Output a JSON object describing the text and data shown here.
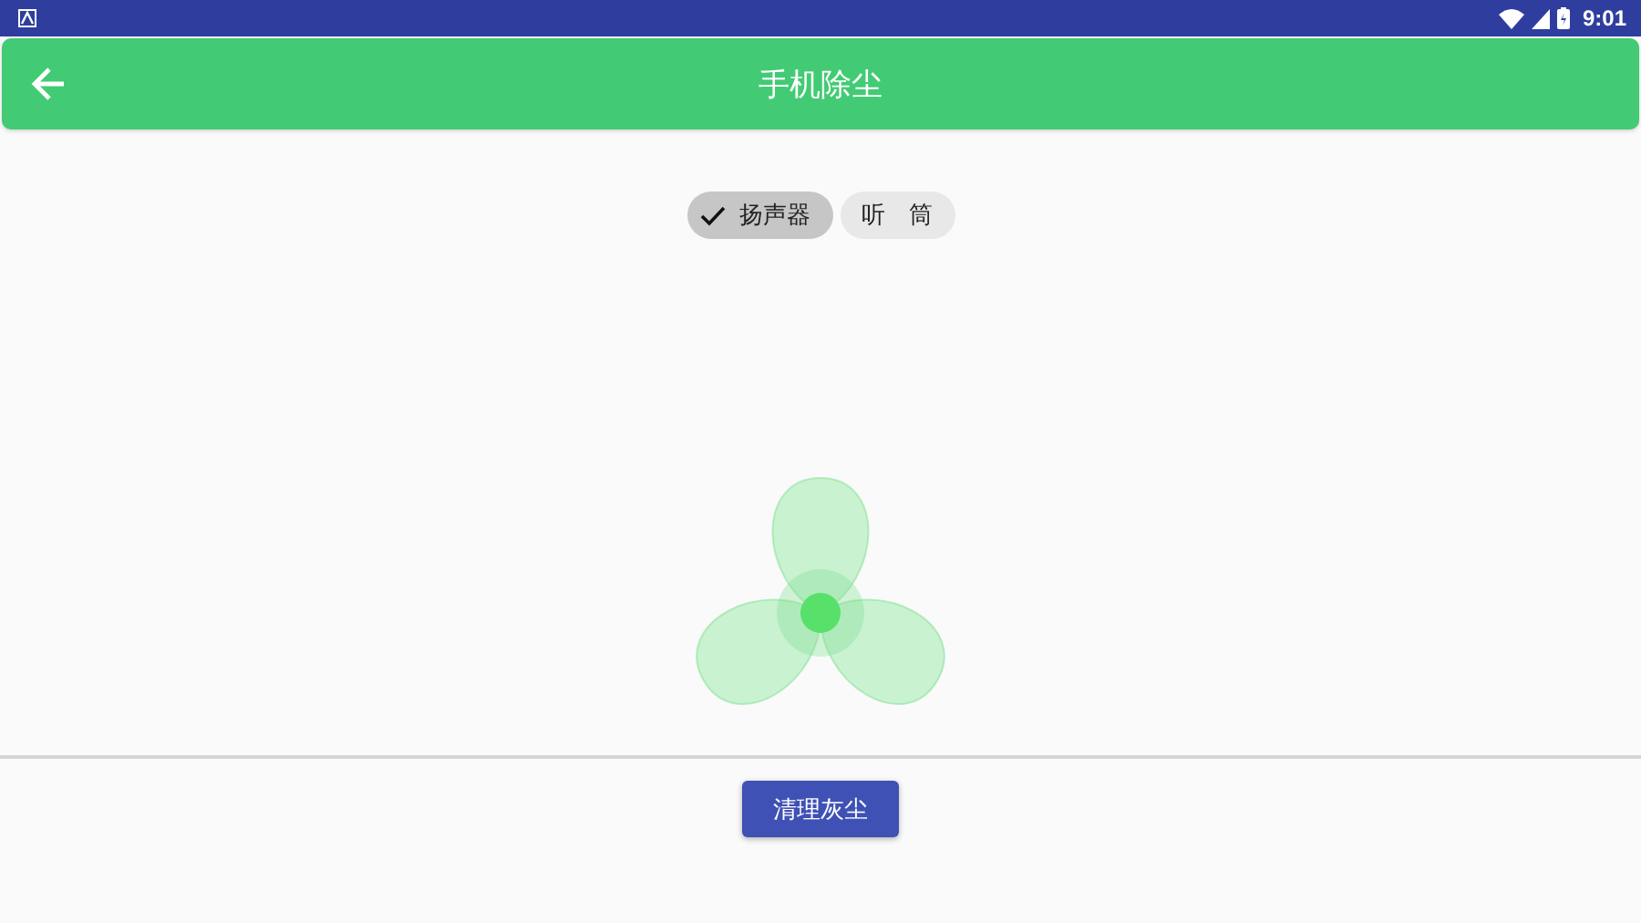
{
  "status_bar": {
    "time": "9:01"
  },
  "toolbar": {
    "title": "手机除尘"
  },
  "chips": [
    {
      "label": "扬声器",
      "selected": true
    },
    {
      "label": "听　筒",
      "selected": false
    }
  ],
  "action_button": {
    "label": "清理灰尘"
  }
}
